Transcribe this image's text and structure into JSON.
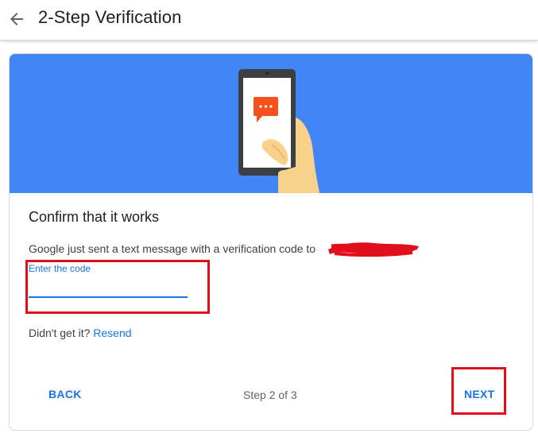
{
  "header": {
    "title": "2-Step Verification",
    "back_icon": "arrow-back-icon"
  },
  "colors": {
    "hero_background": "#4285f4",
    "accent": "#1a73e8",
    "annotation_red": "#e10e1c"
  },
  "card": {
    "illustration": "phone-in-hand-with-message-icon",
    "heading": "Confirm that it works",
    "message": "Google just sent a text message with a verification code to",
    "code_field": {
      "label": "Enter the code",
      "value": ""
    },
    "resend": {
      "prompt": "Didn't get it?",
      "link": "Resend"
    },
    "footer": {
      "back_label": "BACK",
      "step_text": "Step 2 of 3",
      "next_label": "NEXT"
    }
  }
}
